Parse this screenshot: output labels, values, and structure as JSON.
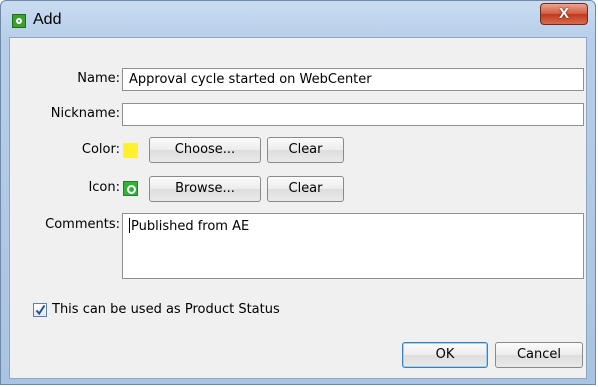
{
  "window": {
    "title": "Add",
    "close_label": "X"
  },
  "form": {
    "name_label": "Name:",
    "name_value": "Approval cycle started on WebCenter",
    "nickname_label": "Nickname:",
    "nickname_value": "",
    "color_label": "Color:",
    "color_value": "#fff12b",
    "choose_label": "Choose...",
    "color_clear_label": "Clear",
    "icon_label": "Icon:",
    "icon_name": "green-status-icon",
    "browse_label": "Browse...",
    "icon_clear_label": "Clear",
    "comments_label": "Comments:",
    "comments_value": "Published from AE",
    "product_status_label": "This can be used as Product Status",
    "product_status_checked": true
  },
  "actions": {
    "ok_label": "OK",
    "cancel_label": "Cancel"
  }
}
